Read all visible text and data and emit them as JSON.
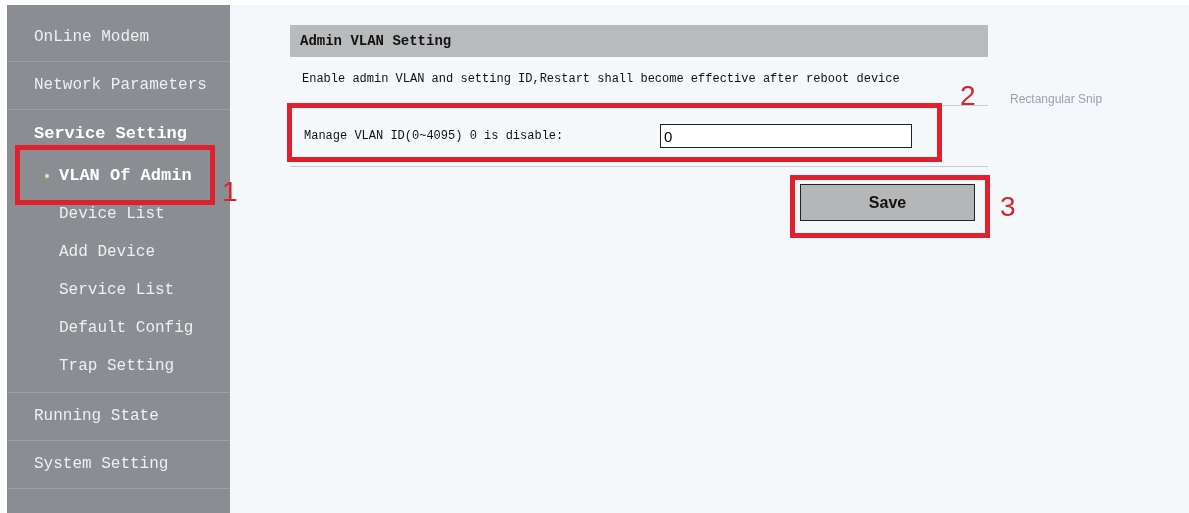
{
  "sidebar": {
    "items": [
      {
        "label": "OnLine Modem",
        "selected": false
      },
      {
        "label": "Network Parameters",
        "selected": false
      },
      {
        "label": "Service Setting",
        "selected": true,
        "expanded": true,
        "children": [
          {
            "label": "VLAN Of Admin",
            "selected": true
          },
          {
            "label": "Device List",
            "selected": false
          },
          {
            "label": "Add Device",
            "selected": false
          },
          {
            "label": "Service List",
            "selected": false
          },
          {
            "label": "Default Config",
            "selected": false
          },
          {
            "label": "Trap Setting",
            "selected": false
          }
        ]
      },
      {
        "label": "Running State",
        "selected": false
      },
      {
        "label": "System Setting",
        "selected": false
      }
    ]
  },
  "panel": {
    "title": "Admin VLAN Setting",
    "description": "Enable admin VLAN and setting ID,Restart shall become effective after reboot device",
    "field": {
      "label": "Manage VLAN ID(0~4095) 0 is disable:",
      "value": "0"
    },
    "save_button": "Save"
  },
  "snip_hint": "Rectangular Snip",
  "annotations": [
    {
      "label": "1"
    },
    {
      "label": "2"
    },
    {
      "label": "3"
    }
  ]
}
